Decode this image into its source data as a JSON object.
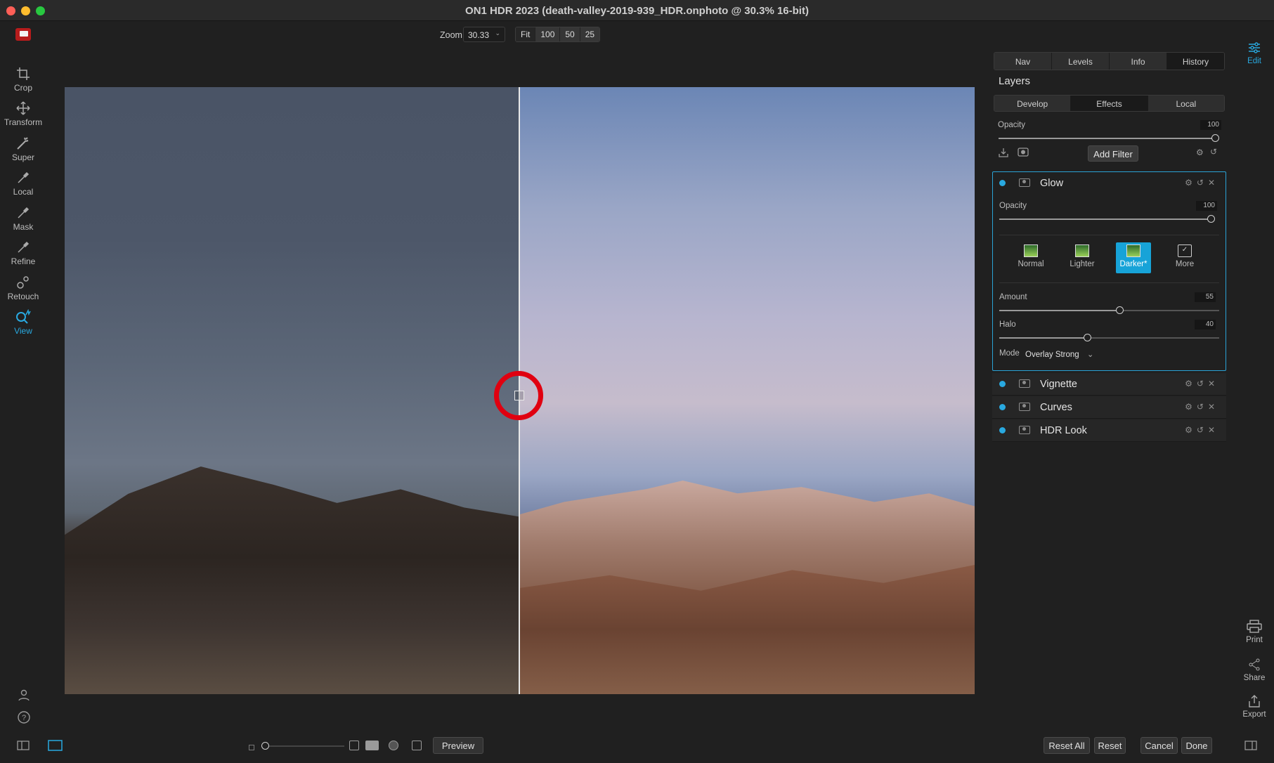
{
  "window": {
    "title": "ON1 HDR 2023 (death-valley-2019-939_HDR.onphoto @ 30.3% 16-bit)"
  },
  "topbar": {
    "zoom_label": "Zoom",
    "zoom_value": "30.33",
    "zoom_buttons": [
      "Fit",
      "100",
      "50",
      "25"
    ]
  },
  "tools": [
    {
      "label": "Crop",
      "icon": "crop-icon"
    },
    {
      "label": "Transform",
      "icon": "transform-icon"
    },
    {
      "label": "Super",
      "icon": "super-icon"
    },
    {
      "label": "Local",
      "icon": "local-brush-icon"
    },
    {
      "label": "Mask",
      "icon": "mask-brush-icon"
    },
    {
      "label": "Refine",
      "icon": "refine-brush-icon"
    },
    {
      "label": "Retouch",
      "icon": "retouch-icon"
    },
    {
      "label": "View",
      "icon": "view-icon",
      "active": true
    }
  ],
  "panel": {
    "tabs": [
      "Nav",
      "Levels",
      "Info",
      "History"
    ],
    "layers_title": "Layers",
    "subtabs": [
      "Develop",
      "Effects",
      "Local"
    ],
    "active_subtab": "Effects",
    "opacity_label": "Opacity",
    "opacity_value": "100",
    "add_filter": "Add Filter",
    "glow": {
      "name": "Glow",
      "opacity_label": "Opacity",
      "opacity_value": "100",
      "presets": [
        "Normal",
        "Lighter",
        "Darker*",
        "More"
      ],
      "active_preset": "Darker*",
      "amount_label": "Amount",
      "amount_value": "55",
      "halo_label": "Halo",
      "halo_value": "40",
      "mode_label": "Mode",
      "mode_value": "Overlay Strong"
    },
    "filters": [
      "Vignette",
      "Curves",
      "HDR Look"
    ]
  },
  "right_rail": {
    "edit": "Edit",
    "print": "Print",
    "share": "Share",
    "export": "Export"
  },
  "bottombar": {
    "preview": "Preview",
    "reset_all": "Reset All",
    "reset": "Reset",
    "cancel": "Cancel",
    "done": "Done"
  },
  "colors": {
    "accent": "#29a9e0",
    "split_ring": "#e00010"
  }
}
